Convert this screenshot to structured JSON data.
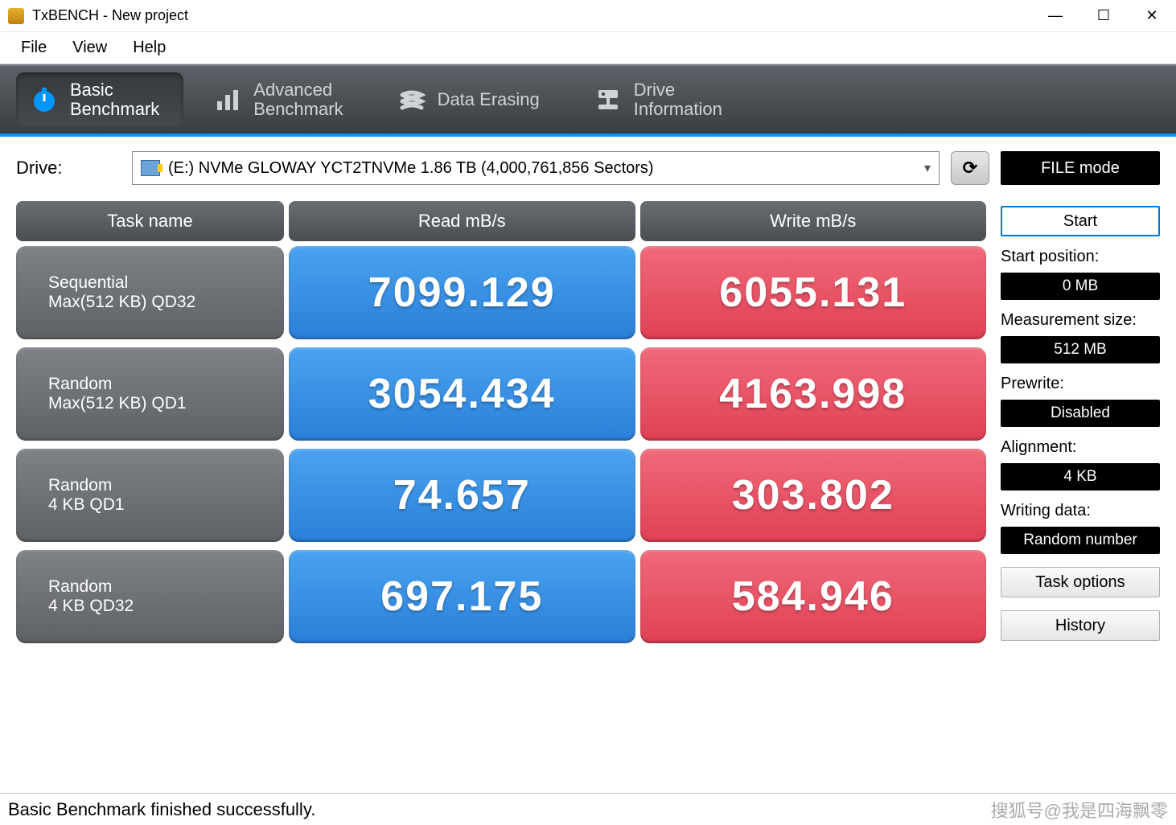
{
  "window": {
    "title": "TxBENCH - New project"
  },
  "menu": {
    "file": "File",
    "view": "View",
    "help": "Help"
  },
  "tabs": {
    "basic": {
      "line1": "Basic",
      "line2": "Benchmark"
    },
    "advanced": {
      "line1": "Advanced",
      "line2": "Benchmark"
    },
    "erasing": {
      "line1": "Data Erasing"
    },
    "drive": {
      "line1": "Drive",
      "line2": "Information"
    }
  },
  "drive": {
    "label": "Drive:",
    "value": "(E:) NVMe GLOWAY YCT2TNVMe  1.86 TB (4,000,761,856 Sectors)"
  },
  "file_mode": "FILE mode",
  "headers": {
    "task": "Task name",
    "read": "Read mB/s",
    "write": "Write mB/s"
  },
  "rows": [
    {
      "name1": "Sequential",
      "name2": "Max(512 KB) QD32",
      "read": "7099.129",
      "write": "6055.131"
    },
    {
      "name1": "Random",
      "name2": "Max(512 KB) QD1",
      "read": "3054.434",
      "write": "4163.998"
    },
    {
      "name1": "Random",
      "name2": "4 KB QD1",
      "read": "74.657",
      "write": "303.802"
    },
    {
      "name1": "Random",
      "name2": "4 KB QD32",
      "read": "697.175",
      "write": "584.946"
    }
  ],
  "sidebar": {
    "start": "Start",
    "start_position_label": "Start position:",
    "start_position_value": "0 MB",
    "measurement_label": "Measurement size:",
    "measurement_value": "512 MB",
    "prewrite_label": "Prewrite:",
    "prewrite_value": "Disabled",
    "alignment_label": "Alignment:",
    "alignment_value": "4 KB",
    "writing_label": "Writing data:",
    "writing_value": "Random number",
    "task_options": "Task options",
    "history": "History"
  },
  "status": "Basic Benchmark finished successfully.",
  "watermark": "搜狐号@我是四海飘零"
}
